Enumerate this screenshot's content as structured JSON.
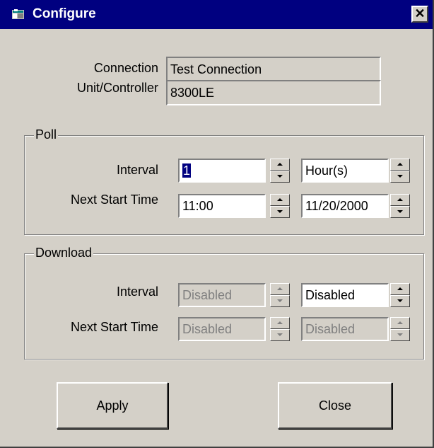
{
  "window": {
    "title": "Configure",
    "close_glyph": "✕",
    "icon": "window-app-icon"
  },
  "connection": {
    "connection_label": "Connection",
    "connection_value": "Test Connection",
    "unit_label": "Unit/Controller",
    "unit_value": "8300LE"
  },
  "poll": {
    "group_label": "Poll",
    "interval_label": "Interval",
    "interval_value": "1",
    "interval_unit": "Hour(s)",
    "next_start_label": "Next Start Time",
    "next_start_time": "11:00",
    "next_start_date": "11/20/2000"
  },
  "download": {
    "group_label": "Download",
    "interval_label": "Interval",
    "interval_value": "Disabled",
    "interval_unit": "Disabled",
    "next_start_label": "Next Start Time",
    "next_start_time": "Disabled",
    "next_start_date": "Disabled"
  },
  "buttons": {
    "apply_label": "Apply",
    "close_label": "Close"
  },
  "colors": {
    "titlebar": "#000080",
    "face": "#d4d0c8",
    "selection": "#000080"
  }
}
